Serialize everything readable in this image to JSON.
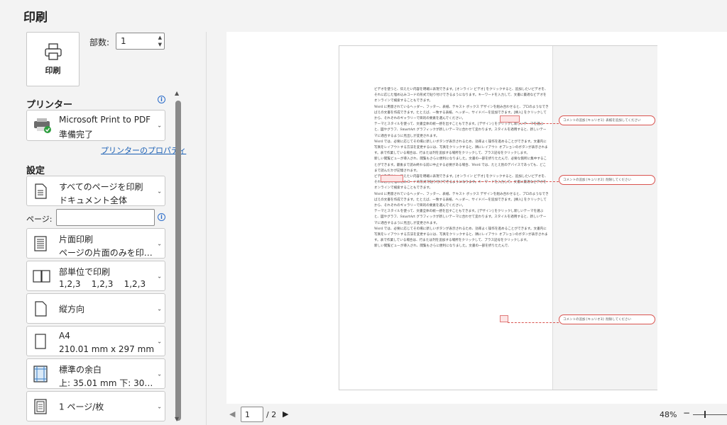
{
  "title": "印刷",
  "print_button": {
    "label": "印刷"
  },
  "copies": {
    "label": "部数:",
    "value": "1"
  },
  "printer": {
    "heading": "プリンター",
    "name": "Microsoft Print to PDF",
    "status": "準備完了",
    "properties_link": "プリンターのプロパティ"
  },
  "settings": {
    "heading": "設定",
    "pages_label": "ページ:",
    "pages_value": "",
    "items": [
      {
        "line1": "すべてのページを印刷",
        "line2": "ドキュメント全体"
      },
      {
        "line1": "片面印刷",
        "line2": "ページの片面のみを印刷し…"
      },
      {
        "line1": "部単位で印刷",
        "line2": "1,2,3    1,2,3    1,2,3"
      },
      {
        "line1": "縦方向",
        "line2": ""
      },
      {
        "line1": "A4",
        "line2": "210.01 mm x 297 mm"
      },
      {
        "line1": "標準の余白",
        "line2": "上: 35.01 mm 下: 30…"
      },
      {
        "line1": "1 ページ/枚",
        "line2": ""
      }
    ]
  },
  "preview": {
    "paragraphs": [
      "ビデオを使うと、伝えたい内容を明確に表現できます。[オンライン ビデオ] をクリックすると、追加したいビデオを、それに応じた埋め込みコードの形式で貼り付けできるようになります。キーワードを入力して、文書に最適なビデオをオンラインで検索することもできます。",
      "Word に用意されているヘッダー、フッター、表紙、テキスト ボックス デザインを組み合わせると、プロのようなできばえの文書を作成できます。たとえば、一致する表紙、ヘッダー、サイドバーを追加できます。[挿入] をクリックしてから、それぞれのギャラリーで目的の要素を選んでください。",
      "テーマとスタイルを使って、文書全体の統一感を出すこともできます。[デザイン] をクリックし新しいテーマを選ぶと、図やグラフ、SmartArt グラフィックが新しいテーマに合わせて変わります。スタイルを適用すると、新しいテーマに適合するように見出しが変更されます。",
      "Word では、必要に応じてその場に新しいボタンが表示されるため、効率よく操作を進めることができます。文書内に写真をレイアウトする方法を変更するには、写真をクリックすると、隣にレイアウト オプションのボタンが表示されます。表で作業している場合は、行または列を追加する場所をクリックして、プラス記号をクリックします。",
      "新しい閲覧ビューが導入され、閲覧もさらに便利になりました。文書の一部を折りたたんで、必要な箇所に集中することができます。最後まで読み終わる前に中止する必要がある場合、Word では、たとえ別のデバイスであっても、どこまで読んだかが記憶されます。",
      "ビデオを使うと、伝えたい内容を明確に表現できます。[オンライン ビデオ] をクリックすると、追加したいビデオを、それに応じた埋め込みコードの形式で貼り付けできるようになります。キーワードを入力して、文書に最適なビデオをオンラインで検索することもできます。",
      "Word に用意されているヘッダー、フッター、表紙、テキスト ボックス デザインを組み合わせると、プロのようなできばえの文書を作成できます。たとえば、一致する表紙、ヘッダー、サイドバーを追加できます。[挿入] をクリックしてから、それぞれのギャラリーで目的の要素を選んでください。",
      "テーマとスタイルを使って、文書全体の統一感を出すこともできます。[デザイン] をクリックし新しいテーマを選ぶと、図やグラフ、SmartArt グラフィックが新しいテーマに合わせて変わります。スタイルを適用すると、新しいテーマに適合するように見出しが変更されます。",
      "Word では、必要に応じてその場に新しいボタンが表示されるため、効率よく操作を進めることができます。文書内に写真をレイアウトする方法を変更するには、写真をクリックすると、隣にレイアウト オプションのボタンが表示されます。表で作業している場合は、行または列を追加する場所をクリックして、プラス記号をクリックします。",
      "新しい閲覧ビューが導入され、閲覧もさらに便利になりました。文書の一部を折りたたんで、"
    ],
    "comments": [
      "コメントの追加 [キュリオ1]: 表紙を追加してください",
      "コメントの追加 [キュリオ2]: 削除してください",
      "コメントの追加 [キュリオ3]: 削除してください"
    ]
  },
  "navigation": {
    "current_page": "1",
    "total": "/ 2",
    "zoom": "48%"
  }
}
